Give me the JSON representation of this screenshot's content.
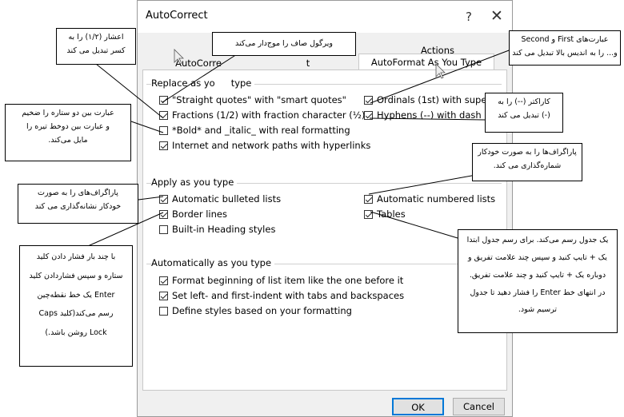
{
  "dialog": {
    "title": "AutoCorrect",
    "help_label": "?",
    "close_label": "✕",
    "tabs": [
      {
        "label": "AutoCorrect",
        "active": false
      },
      {
        "label": "Math AutoCorrect",
        "active": false
      },
      {
        "label": "Actions",
        "active": false
      },
      {
        "label": "AutoFormat As You Type",
        "active": true
      }
    ],
    "tab_row1_label": "Actions",
    "tab_autocorrect_partial": "AutoCorre",
    "tab_math_partial": "t",
    "replace_group": {
      "label": "Replace as you type",
      "visible_label": "Replace as yo",
      "visible_label_tail": "type",
      "items_left": [
        {
          "label": "\"Straight quotes\" with \"smart quotes\"",
          "checked": true
        },
        {
          "label": "Fractions (1/2) with fraction character (½)",
          "checked": true
        },
        {
          "label": "*Bold* and _italic_ with real formatting",
          "checked": false
        },
        {
          "label": "Internet and network paths with hyperlinks",
          "checked": true
        }
      ],
      "items_right": [
        {
          "label": "Ordinals (1st) with superscript",
          "checked": true
        },
        {
          "label": "Hyphens (--) with dash (—)",
          "checked": true
        }
      ]
    },
    "apply_group": {
      "label": "Apply as you type",
      "items_left": [
        {
          "label": "Automatic bulleted lists",
          "checked": true
        },
        {
          "label": "Border lines",
          "checked": true
        },
        {
          "label": "Built-in Heading styles",
          "checked": false
        }
      ],
      "items_right": [
        {
          "label": "Automatic numbered lists",
          "checked": true
        },
        {
          "label": "Tables",
          "checked": true
        }
      ]
    },
    "auto_group": {
      "label": "Automatically as you type",
      "items": [
        {
          "label": "Format beginning of list item like the one before it",
          "checked": true
        },
        {
          "label": "Set left- and first-indent with tabs and backspaces",
          "checked": true
        },
        {
          "label": "Define styles based on your formatting",
          "checked": false
        }
      ]
    },
    "ok_label": "OK",
    "cancel_label": "Cancel"
  },
  "callouts": {
    "fraction": [
      "اعشار (۱/۲) را به",
      "کسر تبدیل می کند"
    ],
    "comma": [
      "ویرگول صاف را موج‌دار می‌کند"
    ],
    "ordinals": [
      "عبارت‌های First و Second",
      "و... را به اندیس بالا تبدیل می کند"
    ],
    "bold_italic": [
      "عبارت بین دو ستاره را ضخیم",
      "و عبارت بین دوخط تیره را",
      "مایل می‌کند."
    ],
    "hyphen": [
      "کاراکتر (--) را به",
      "(-) تبدیل می کند"
    ],
    "numbered": [
      "پاراگراف‌ها را به صورت خودکار",
      "شماره‌گذاری می کند."
    ],
    "bulleted": [
      "پاراگراف‌های را به صورت",
      "خودکار نشانه‌گذاری می کند"
    ],
    "tables": [
      "یک جدول رسم می‌کند. برای رسم جدول ابتدا",
      "یک + تایپ کنید و سپس چند علامت تفریق و",
      "دوباره یک + تایپ کنید و چند علامت تفریق.",
      "در انتهای خط Enter را فشار دهید تا جدول",
      "ترسیم شود."
    ],
    "border": [
      "با چند بار فشار دادن کلید",
      "ستاره و سپس فشاردادن کلید",
      "Enter یک خط نقطه‌چین",
      "رسم می‌کند(کلید Caps",
      "Lock روشن باشد.)"
    ]
  }
}
